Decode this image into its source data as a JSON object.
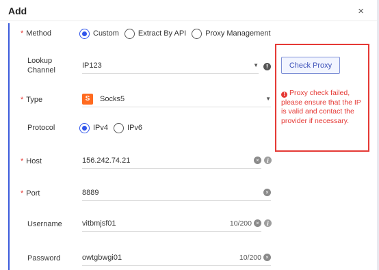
{
  "dialog": {
    "title": "Add",
    "close_glyph": "×"
  },
  "method": {
    "label": "Method",
    "required_mark": "*",
    "options": [
      "Custom",
      "Extract By API",
      "Proxy Management"
    ],
    "selected": "Custom"
  },
  "lookup": {
    "label": "Lookup Channel",
    "value": "IP123",
    "caret": "▼",
    "info_glyph": "!"
  },
  "type": {
    "label": "Type",
    "required_mark": "*",
    "icon_letter": "S",
    "value": "Socks5",
    "caret": "▼",
    "icon_color": "#ff6a1f"
  },
  "protocol": {
    "label": "Protocol",
    "options": [
      "IPv4",
      "IPv6"
    ],
    "selected": "IPv4"
  },
  "host": {
    "label": "Host",
    "required_mark": "*",
    "value": "156.242.74.21"
  },
  "port": {
    "label": "Port",
    "required_mark": "*",
    "value": "8889"
  },
  "username": {
    "label": "Username",
    "value": "vitbmjsf01",
    "counter": "10/200"
  },
  "password": {
    "label": "Password",
    "value": "owtgbwgi01",
    "counter": "10/200"
  },
  "check": {
    "button_label": "Check Proxy",
    "error_message": "Proxy check failed, please ensure that the IP is valid and contact the provider if necessary.",
    "error_glyph": "!",
    "error_color": "#e53935"
  },
  "icons": {
    "clear_glyph": "×",
    "info_glyph": "i"
  },
  "colors": {
    "accent": "#2f54eb",
    "error": "#e53935",
    "rail": "#3b5bdb"
  }
}
